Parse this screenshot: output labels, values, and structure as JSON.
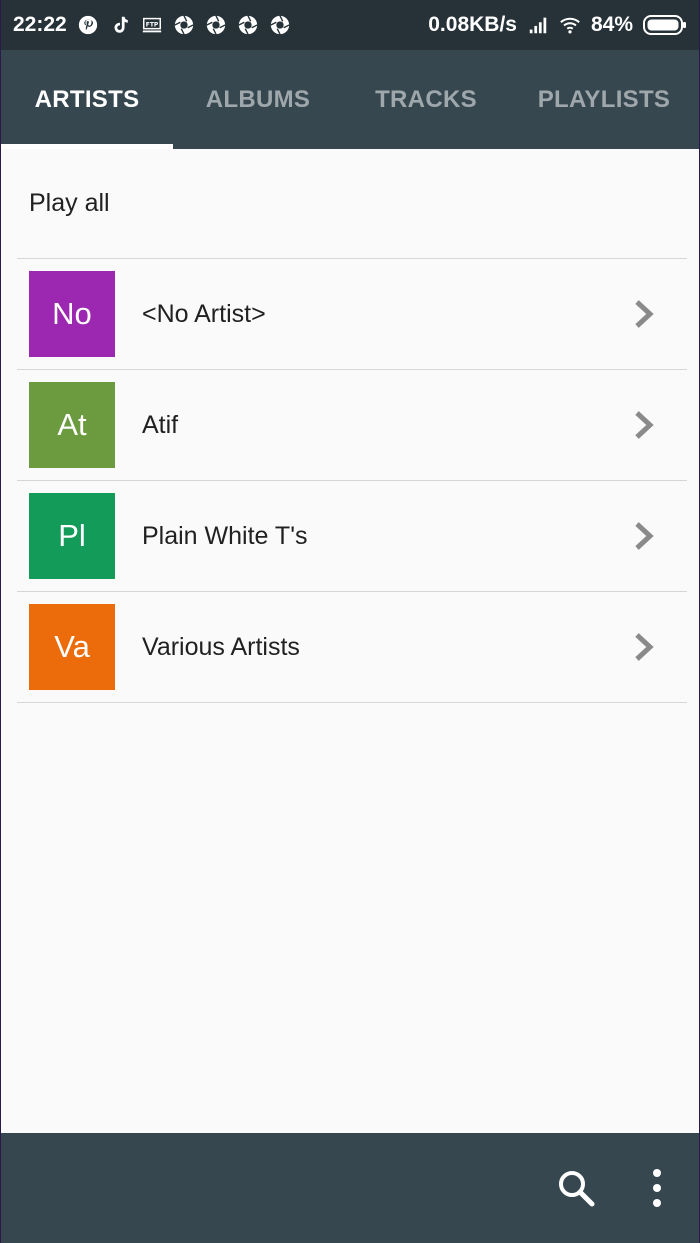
{
  "status_bar": {
    "time": "22:22",
    "speed": "0.08KB/s",
    "battery": "84%",
    "icons": [
      "pinterest-icon",
      "tiktok-icon",
      "ftp-icon",
      "shutter-icon",
      "shutter-icon",
      "shutter-icon",
      "shutter-icon",
      "signal-icon",
      "wifi-icon",
      "battery-icon"
    ]
  },
  "tabs": [
    {
      "label": "ARTISTS",
      "active": true
    },
    {
      "label": "ALBUMS",
      "active": false
    },
    {
      "label": "TRACKS",
      "active": false
    },
    {
      "label": "PLAYLISTS",
      "active": false
    }
  ],
  "play_all_label": "Play all",
  "artists": [
    {
      "initials": "No",
      "name": "<No Artist>",
      "color": "#9c27b0"
    },
    {
      "initials": "At",
      "name": "Atif",
      "color": "#6b9a3f"
    },
    {
      "initials": "Pl",
      "name": "Plain White T's",
      "color": "#139b5a"
    },
    {
      "initials": "Va",
      "name": "Various Artists",
      "color": "#ec6c0c"
    }
  ],
  "colors": {
    "status_bar_bg": "#263238",
    "toolbar_bg": "#37474f",
    "content_bg": "#fafafa"
  },
  "bottom_bar": {
    "icons": [
      "search-icon",
      "more-vert-icon"
    ]
  }
}
